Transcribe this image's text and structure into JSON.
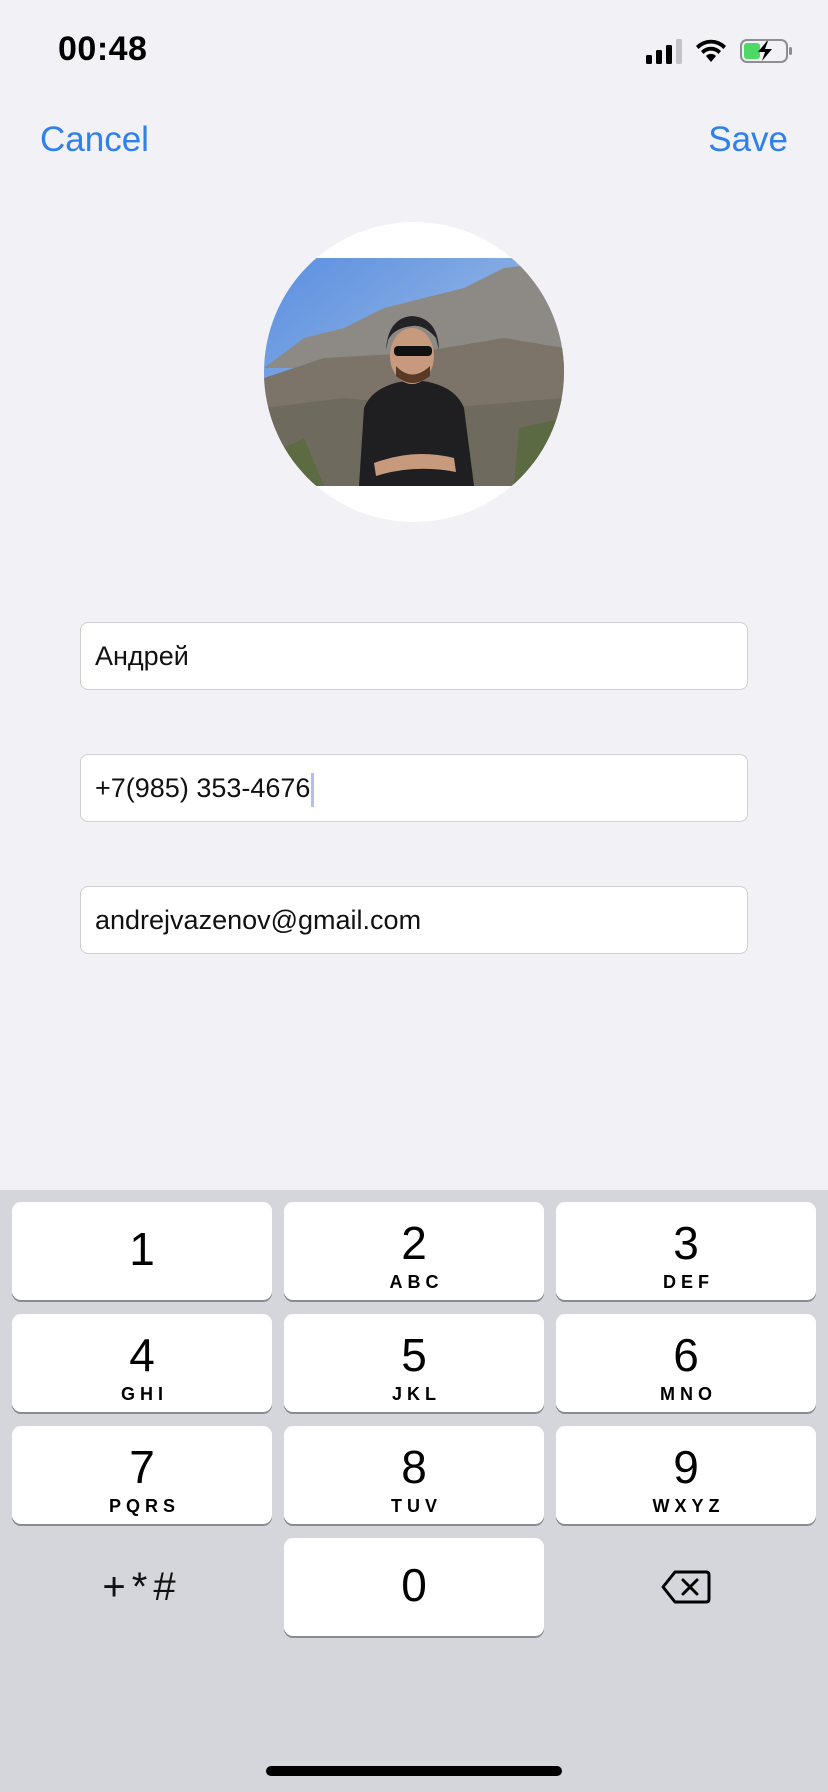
{
  "status_bar": {
    "time": "00:48",
    "icons": [
      "cellular-signal-icon",
      "wifi-icon",
      "battery-charging-icon"
    ],
    "battery_color": "#4cd964"
  },
  "nav": {
    "cancel_label": "Cancel",
    "save_label": "Save",
    "accent_color": "#2f80ea"
  },
  "contact": {
    "name": "Андрей",
    "phone": "+7(985) 353-4676",
    "email": "andrejvazenov@gmail.com"
  },
  "keypad": {
    "keys": [
      {
        "num": "1",
        "letters": ""
      },
      {
        "num": "2",
        "letters": "ABC"
      },
      {
        "num": "3",
        "letters": "DEF"
      },
      {
        "num": "4",
        "letters": "GHI"
      },
      {
        "num": "5",
        "letters": "JKL"
      },
      {
        "num": "6",
        "letters": "MNO"
      },
      {
        "num": "7",
        "letters": "PQRS"
      },
      {
        "num": "8",
        "letters": "TUV"
      },
      {
        "num": "9",
        "letters": "WXYZ"
      },
      {
        "num": "0",
        "letters": ""
      }
    ],
    "symbols_label": "+*#",
    "delete_icon": "backspace-icon"
  }
}
